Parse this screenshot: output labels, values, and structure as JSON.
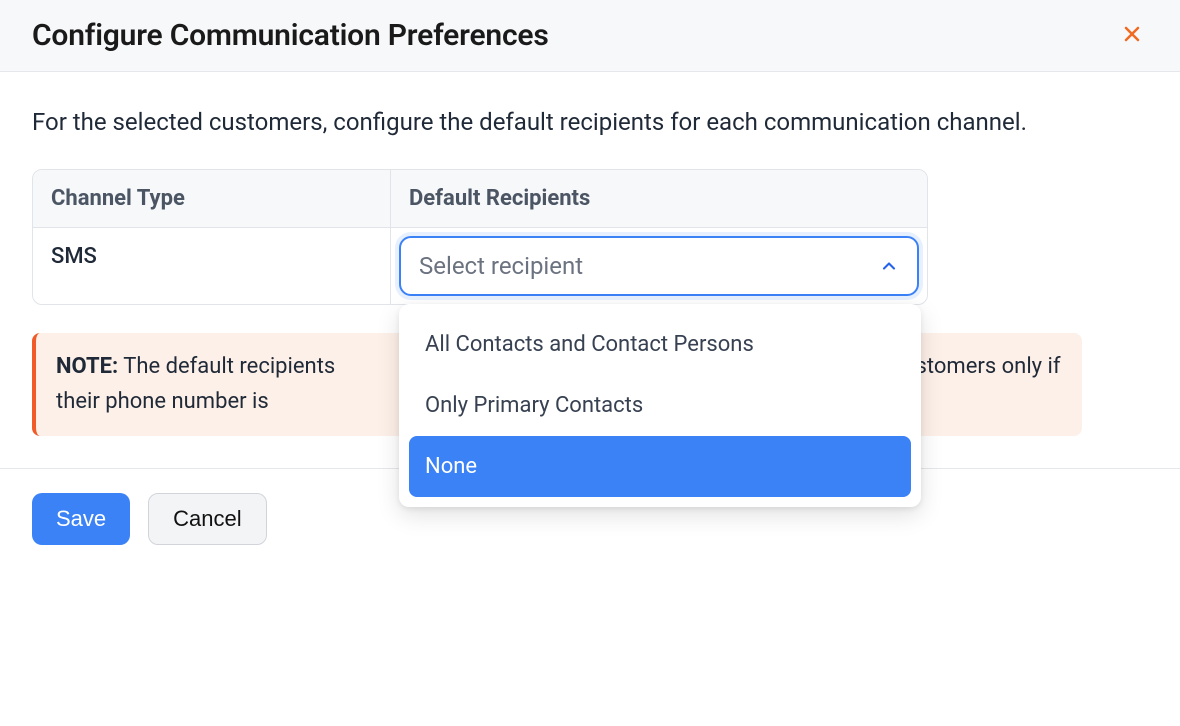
{
  "header": {
    "title": "Configure Communication Preferences"
  },
  "body": {
    "description": "For the selected customers, configure the default recipients for each communication channel.",
    "table": {
      "headers": {
        "channel": "Channel Type",
        "recipients": "Default Recipients"
      },
      "row": {
        "channel": "SMS",
        "placeholder": "Select recipient"
      }
    },
    "dropdown": {
      "options": [
        {
          "label": "All Contacts and Contact Persons",
          "selected": false
        },
        {
          "label": "Only Primary Contacts",
          "selected": false
        },
        {
          "label": "None",
          "selected": true
        }
      ]
    },
    "note": {
      "label": "NOTE:",
      "text_before": " The default recipients ",
      "text_after": " customers only if their phone number is "
    }
  },
  "footer": {
    "save": "Save",
    "cancel": "Cancel"
  }
}
